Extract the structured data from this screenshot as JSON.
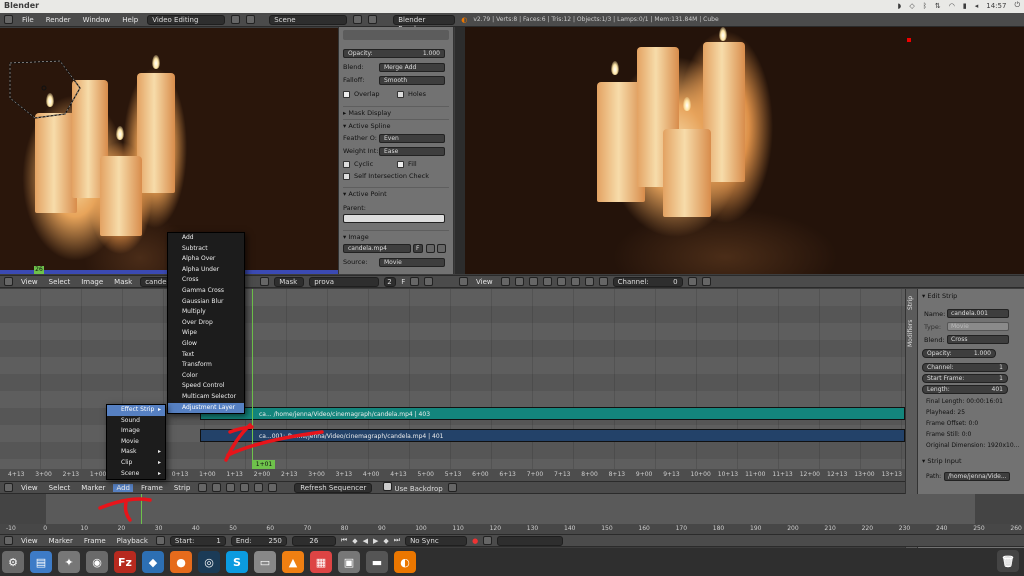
{
  "os_title": "Blender",
  "clock": "14:57",
  "info_header": {
    "menus": [
      "File",
      "Render",
      "Window",
      "Help"
    ],
    "screen_layout": "Video Editing",
    "scene": "Scene",
    "render_engine": "Blender Render",
    "stats": "v2.79 | Verts:8 | Faces:6 | Tris:12 | Objects:1/3 | Lamps:0/1 | Mem:131.84M | Cube"
  },
  "mask_props": {
    "opacity_label": "Opacity:",
    "opacity_value": "1.000",
    "blend_label": "Blend:",
    "blend_value": "Merge Add",
    "falloff_label": "Falloff:",
    "falloff_value": "Smooth",
    "overlap_label": "Overlap",
    "holes_label": "Holes",
    "mask_display": "Mask Display",
    "active_spline": "Active Spline",
    "feather_label": "Feather O:",
    "feather_value": "Even",
    "weight_label": "Weight Int:",
    "weight_value": "Ease",
    "cyclic_label": "Cyclic",
    "fill_label": "Fill",
    "self_intersection": "Self Intersection Check",
    "active_point": "Active Point",
    "parent_label": "Parent:",
    "image_section": "Image",
    "image_file": "candela.mp4",
    "image_user_count": "F",
    "source_label": "Source:",
    "source_value": "Movie"
  },
  "left_header": {
    "menus": [
      "View",
      "Select",
      "Image",
      "Mask"
    ],
    "image_name": "candela",
    "mask_mode": "Mask",
    "mask_name": "prova",
    "mask_users": "2",
    "mask_fake": "F"
  },
  "right_header": {
    "menus": [
      "View"
    ],
    "channel_label": "Channel:",
    "channel_value": "0"
  },
  "left_frame_badge": "26",
  "add_menu": {
    "items": [
      "Effect Strip",
      "Sound",
      "Image",
      "Movie",
      "Mask",
      "Clip",
      "Scene"
    ],
    "active_index": 0
  },
  "effect_menu": {
    "items": [
      "Add",
      "Subtract",
      "Alpha Over",
      "Alpha Under",
      "Cross",
      "Gamma Cross",
      "Gaussian Blur",
      "Multiply",
      "Over Drop",
      "Wipe",
      "Glow",
      "Text",
      "Transform",
      "Color",
      "Speed Control",
      "Multicam Selector",
      "Adjustment Layer"
    ],
    "active_index": 16
  },
  "strips": {
    "teal_label": "ca... /home/jenna/Video/cinemagraph/candela.mp4 | 403",
    "blue_label": "ca...001: /home/jenna/Video/cinemagraph/candela.mp4 | 401"
  },
  "playhead_label": "1+01",
  "seq_ruler": [
    "4+13",
    "3+00",
    "2+13",
    "1+00",
    "0+13",
    "0+00",
    "0+13",
    "1+00",
    "1+13",
    "2+00",
    "2+13",
    "3+00",
    "3+13",
    "4+00",
    "4+13",
    "5+00",
    "5+13",
    "6+00",
    "6+13",
    "7+00",
    "7+13",
    "8+00",
    "8+13",
    "9+00",
    "9+13",
    "10+00",
    "10+13",
    "11+00",
    "11+13",
    "12+00",
    "12+13",
    "13+00",
    "13+13"
  ],
  "seq_header": {
    "menus": [
      "View",
      "Select",
      "Marker",
      "Add",
      "Frame",
      "Strip"
    ],
    "refresh": "Refresh Sequencer",
    "backdrop": "Use Backdrop"
  },
  "strip_panel": {
    "tabs": [
      "Strip",
      "Modifiers"
    ],
    "edit_strip": "Edit Strip",
    "name_label": "Name:",
    "name_value": "candela.001",
    "type_label": "Type:",
    "type_value": "Movie",
    "blend_label": "Blend:",
    "blend_value": "Cross",
    "opacity_label": "Opacity:",
    "opacity_value": "1.000",
    "channel_label": "Channel:",
    "channel_value": "1",
    "start_label": "Start Frame:",
    "start_value": "1",
    "length_label": "Length:",
    "length_value": "401",
    "final_length": "Final Length: 00:00:16:01",
    "playhead": "Playhead: 25",
    "frame_offset": "Frame Offset: 0:0",
    "frame_still": "Frame Still: 0:0",
    "original_dim": "Original Dimension: 1920x10...",
    "strip_input": "Strip Input",
    "path_label": "Path:",
    "path_value": "/home/jenna/Vide..."
  },
  "timeline_header": {
    "menus": [
      "View",
      "Marker",
      "Frame",
      "Playback"
    ],
    "start_label": "Start:",
    "start_value": "1",
    "end_label": "End:",
    "end_value": "250",
    "current": "26",
    "sync": "No Sync"
  },
  "timeline_ruler": [
    "-10",
    "0",
    "10",
    "20",
    "30",
    "40",
    "50",
    "60",
    "70",
    "80",
    "90",
    "100",
    "110",
    "120",
    "130",
    "140",
    "150",
    "160",
    "170",
    "180",
    "190",
    "200",
    "210",
    "220",
    "230",
    "240",
    "250",
    "260"
  ],
  "taskbar_icons": [
    {
      "name": "ubuntu-settings-icon",
      "glyph": "⚙",
      "color": "#6a6a6a"
    },
    {
      "name": "document-app-icon",
      "glyph": "▤",
      "color": "#3d7bc7"
    },
    {
      "name": "system-settings-icon",
      "glyph": "✦",
      "color": "#777"
    },
    {
      "name": "disk-icon",
      "glyph": "◉",
      "color": "#6a6a6a"
    },
    {
      "name": "filezilla-icon",
      "glyph": "Fz",
      "color": "#b72a1f"
    },
    {
      "name": "vscode-icon",
      "glyph": "◆",
      "color": "#2d6fb3"
    },
    {
      "name": "firefox-icon",
      "glyph": "●",
      "color": "#e66b1c"
    },
    {
      "name": "steam-icon",
      "glyph": "◎",
      "color": "#1b3b57"
    },
    {
      "name": "skype-icon",
      "glyph": "S",
      "color": "#0b9be0"
    },
    {
      "name": "drive-icon",
      "glyph": "▭",
      "color": "#888"
    },
    {
      "name": "vlc-icon",
      "glyph": "▲",
      "color": "#ef7f12"
    },
    {
      "name": "calendar-icon",
      "glyph": "▦",
      "color": "#d44"
    },
    {
      "name": "screenshot-icon",
      "glyph": "▣",
      "color": "#777"
    },
    {
      "name": "monitor-icon",
      "glyph": "▬",
      "color": "#555"
    },
    {
      "name": "blender-icon",
      "glyph": "◐",
      "color": "#eb7700"
    }
  ],
  "colors": {
    "teal_strip": "#13857c",
    "blue_strip": "#234269",
    "menu_highlight": "#5680c2",
    "playhead": "#6ec24b",
    "annotation": "#e8141a"
  }
}
